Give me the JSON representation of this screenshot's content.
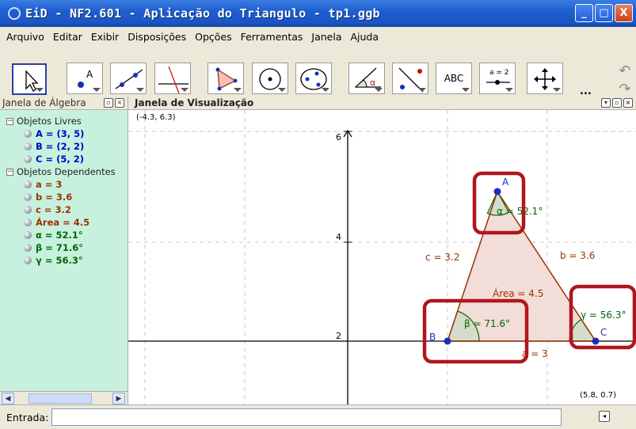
{
  "window": {
    "title": "EiD - NF2.601 - Aplicação do Triangulo - tp1.ggb",
    "minimize": "_",
    "maximize": "□",
    "close": "X"
  },
  "menu": [
    "Arquivo",
    "Editar",
    "Exibir",
    "Disposições",
    "Opções",
    "Ferramentas",
    "Janela",
    "Ajuda"
  ],
  "toolbar": {
    "tools": [
      {
        "name": "move-tool-icon"
      },
      {
        "name": "point-tool-icon",
        "label": "A"
      },
      {
        "name": "line-tool-icon"
      },
      {
        "name": "perpendicular-tool-icon"
      },
      {
        "name": "polygon-tool-icon"
      },
      {
        "name": "circle-center-tool-icon"
      },
      {
        "name": "conic-tool-icon"
      },
      {
        "name": "angle-tool-icon",
        "label": "α"
      },
      {
        "name": "reflect-tool-icon"
      },
      {
        "name": "text-tool-icon",
        "label": "ABC"
      },
      {
        "name": "slider-tool-icon",
        "label": "a = 2"
      },
      {
        "name": "move-view-tool-icon"
      }
    ],
    "more": "..."
  },
  "algebra": {
    "header": "Janela de Álgebra",
    "free_folder": "Objetos Livres",
    "free": [
      "A = (3, 5)",
      "B = (2, 2)",
      "C = (5, 2)"
    ],
    "dependent_folder": "Objetos Dependentes",
    "dependent": [
      {
        "text": "a = 3",
        "color": "#993300"
      },
      {
        "text": "b = 3.6",
        "color": "#993300"
      },
      {
        "text": "c = 3.2",
        "color": "#993300"
      },
      {
        "text": "Área = 4.5",
        "color": "#993300"
      },
      {
        "text": "α = 52.1°",
        "color": "#006600"
      },
      {
        "text": "β = 71.6°",
        "color": "#006600"
      },
      {
        "text": "γ = 56.3°",
        "color": "#006600"
      }
    ],
    "free_color": "#0000cc"
  },
  "graphics": {
    "header": "Janela de Visualização",
    "corner_top_left": "(-4.3, 6.3)",
    "corner_bottom_right": "(5.8, 0.7)",
    "y_ticks": [
      "6",
      "4",
      "2"
    ],
    "labels": {
      "A": "A",
      "B": "B",
      "C": "C",
      "alpha": "α = 52.1°",
      "beta": "β = 71.6°",
      "gamma": "γ = 56.3°",
      "a": "a = 3",
      "b": "b = 3.6",
      "c": "c = 3.2",
      "area": "Área = 4.5"
    },
    "colors": {
      "point": "#1a2fb8",
      "segment": "#993300",
      "angle": "#006600",
      "fill": "#f3ddd8",
      "highlight": "#b0161d"
    }
  },
  "input": {
    "label": "Entrada:",
    "value": "",
    "placeholder": ""
  }
}
